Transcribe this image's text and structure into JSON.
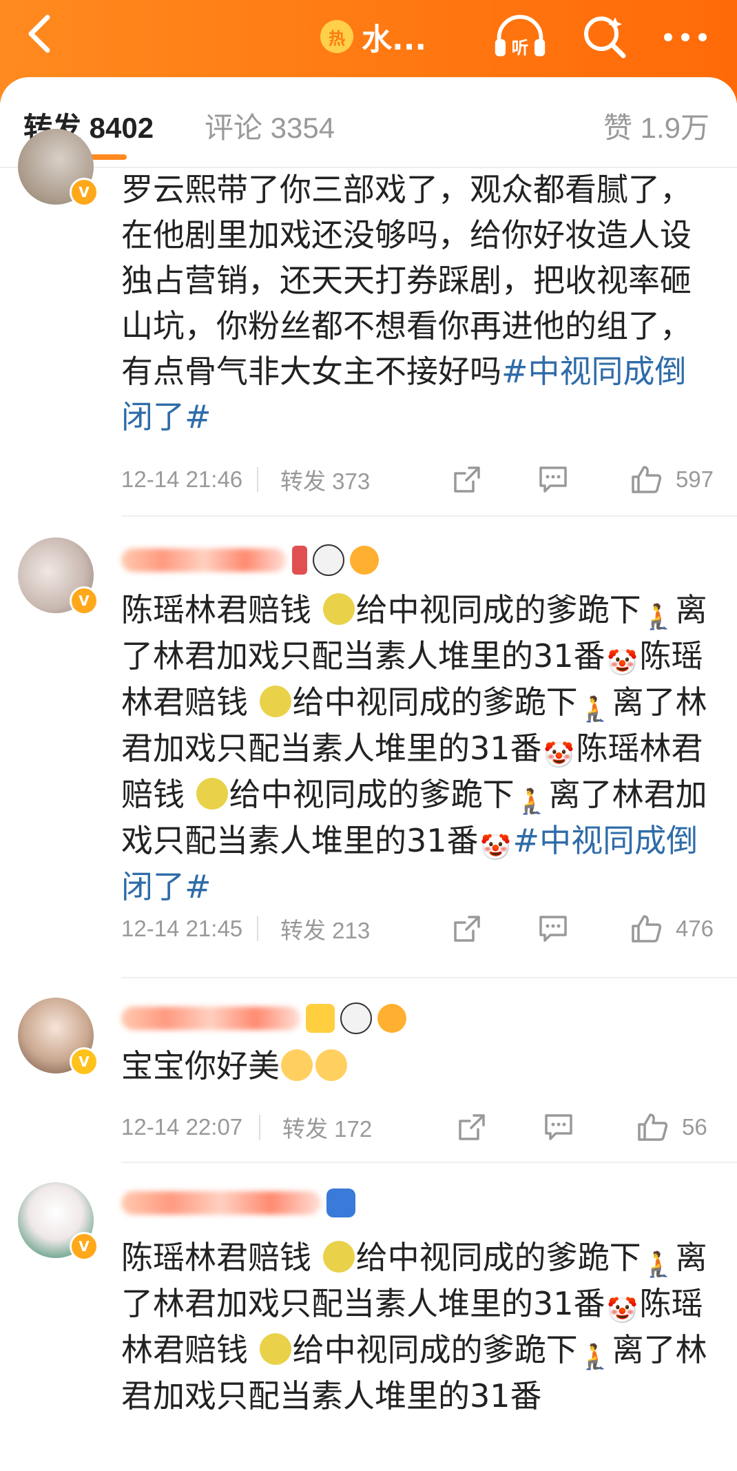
{
  "header": {
    "hot_badge": "热",
    "title": "水...",
    "listen_label": "听",
    "icons": [
      "back-chevron-icon",
      "listen-headphones-icon",
      "search-icon",
      "more-dots-icon"
    ]
  },
  "tabs": {
    "reposts": "转发 8402",
    "comments": "评论 3354",
    "likes": "赞 1.9万"
  },
  "posts": [
    {
      "text": "罗云熙带了你三部戏了，观众都看腻了，在他剧里加戏还没够吗，给你好妆造人设独占营销，还天天打券踩剧，把收视率砸山坑，你粉丝都不想看你再进他的组了，有点骨气非大女主不接好吗",
      "topic": "#中视同成倒闭了#",
      "time": "12-14 21:46",
      "repost": "转发 373",
      "likes": "597"
    },
    {
      "seg_a": "陈瑶林君赔钱 ",
      "seg_b": "给中视同成的爹跪下",
      "seg_c": "离了林君加戏只配当素人堆里的31番",
      "topic": "#中视同成倒闭了#",
      "time": "12-14 21:45",
      "repost": "转发 213",
      "likes": "476"
    },
    {
      "text": "宝宝你好美",
      "time": "12-14 22:07",
      "repost": "转发 172",
      "likes": "56"
    },
    {
      "seg_a": "陈瑶林君赔钱 ",
      "seg_b": "给中视同成的爹跪下",
      "seg_c": "离了林君加戏只配当素人堆里的31番"
    }
  ],
  "colors": {
    "header_orange": "#ff7a12",
    "topic_blue": "#2f6ca8",
    "meta_gray": "#999999",
    "tab_underline": "#ff8a1f"
  }
}
